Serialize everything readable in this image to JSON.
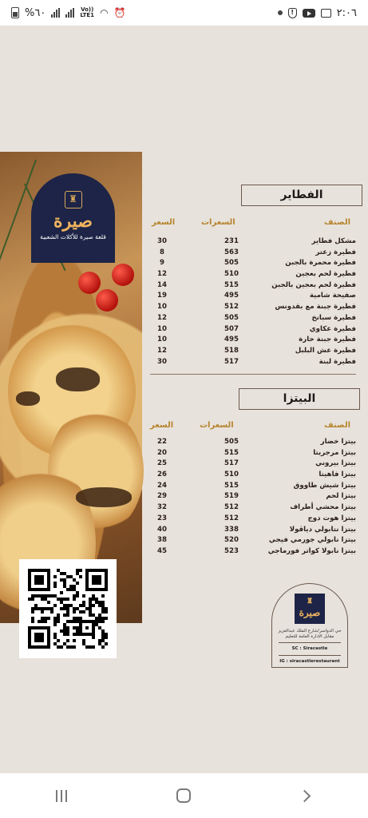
{
  "status_bar": {
    "time": "٢:٠٦",
    "battery": "%٦٠",
    "network": "LTE1",
    "volte": "Vo))"
  },
  "logo": {
    "name": "صيرة",
    "subtitle": "قلعة صيرة للأكلات الشعبية"
  },
  "pies": {
    "title": "الفطاير",
    "headers": {
      "item": "الصنف",
      "calories": "السعرات",
      "price": "السعر"
    },
    "rows": [
      {
        "name": "مشكل فطاير",
        "calories": "231",
        "price": "30"
      },
      {
        "name": "فطيرة زعتر",
        "calories": "563",
        "price": "8"
      },
      {
        "name": "فطيرة محمرة بالجبن",
        "calories": "505",
        "price": "9"
      },
      {
        "name": "فطيرة لحم بعجين",
        "calories": "510",
        "price": "12"
      },
      {
        "name": "فطيرة لحم بعجين بالجبن",
        "calories": "515",
        "price": "14"
      },
      {
        "name": "صفيحة شامية",
        "calories": "495",
        "price": "19"
      },
      {
        "name": "فطيرة جبنة مع بقدونس",
        "calories": "512",
        "price": "10"
      },
      {
        "name": "فطيرة سبانخ",
        "calories": "505",
        "price": "12"
      },
      {
        "name": "فطيرة عكاوي",
        "calories": "507",
        "price": "10"
      },
      {
        "name": "فطيرة جبنة حارة",
        "calories": "495",
        "price": "10"
      },
      {
        "name": "فطيرة عش البلبل",
        "calories": "518",
        "price": "12"
      },
      {
        "name": "فطيرة لبنة",
        "calories": "517",
        "price": "30"
      }
    ]
  },
  "pizza": {
    "title": "البيتزا",
    "headers": {
      "item": "الصنف",
      "calories": "السعرات",
      "price": "السعر"
    },
    "rows": [
      {
        "name": "بيتزا خضار",
        "calories": "505",
        "price": "22"
      },
      {
        "name": "بيتزا مرجريتا",
        "calories": "515",
        "price": "20"
      },
      {
        "name": "بيتزا بيروني",
        "calories": "517",
        "price": "25"
      },
      {
        "name": "بيتزا فاهيتا",
        "calories": "510",
        "price": "26"
      },
      {
        "name": "بيتزا شيش طاووق",
        "calories": "515",
        "price": "24"
      },
      {
        "name": "بيتزا لحم",
        "calories": "519",
        "price": "29"
      },
      {
        "name": "بيتزا محشي أطراف",
        "calories": "512",
        "price": "32"
      },
      {
        "name": "بيتزا هوت دوج",
        "calories": "512",
        "price": "23"
      },
      {
        "name": "بيتزا نتابولي دياڤولا",
        "calories": "338",
        "price": "40"
      },
      {
        "name": "بيتزا نابولي جورمي فيجي",
        "calories": "520",
        "price": "38"
      },
      {
        "name": "بيتزا نابولا كواتر فورماجي",
        "calories": "523",
        "price": "45"
      }
    ]
  },
  "info_card": {
    "logo_name": "صيرة",
    "address": "حي الدواسر/شارع الملك عبدالعزيز مقابل الادارة العامة للتعليم",
    "snapchat": "SC : Siracastle",
    "instagram": "IG : siracastlerestaurant"
  },
  "icons": {
    "recents": "recents-icon",
    "home": "home-icon",
    "back": "back-icon"
  }
}
